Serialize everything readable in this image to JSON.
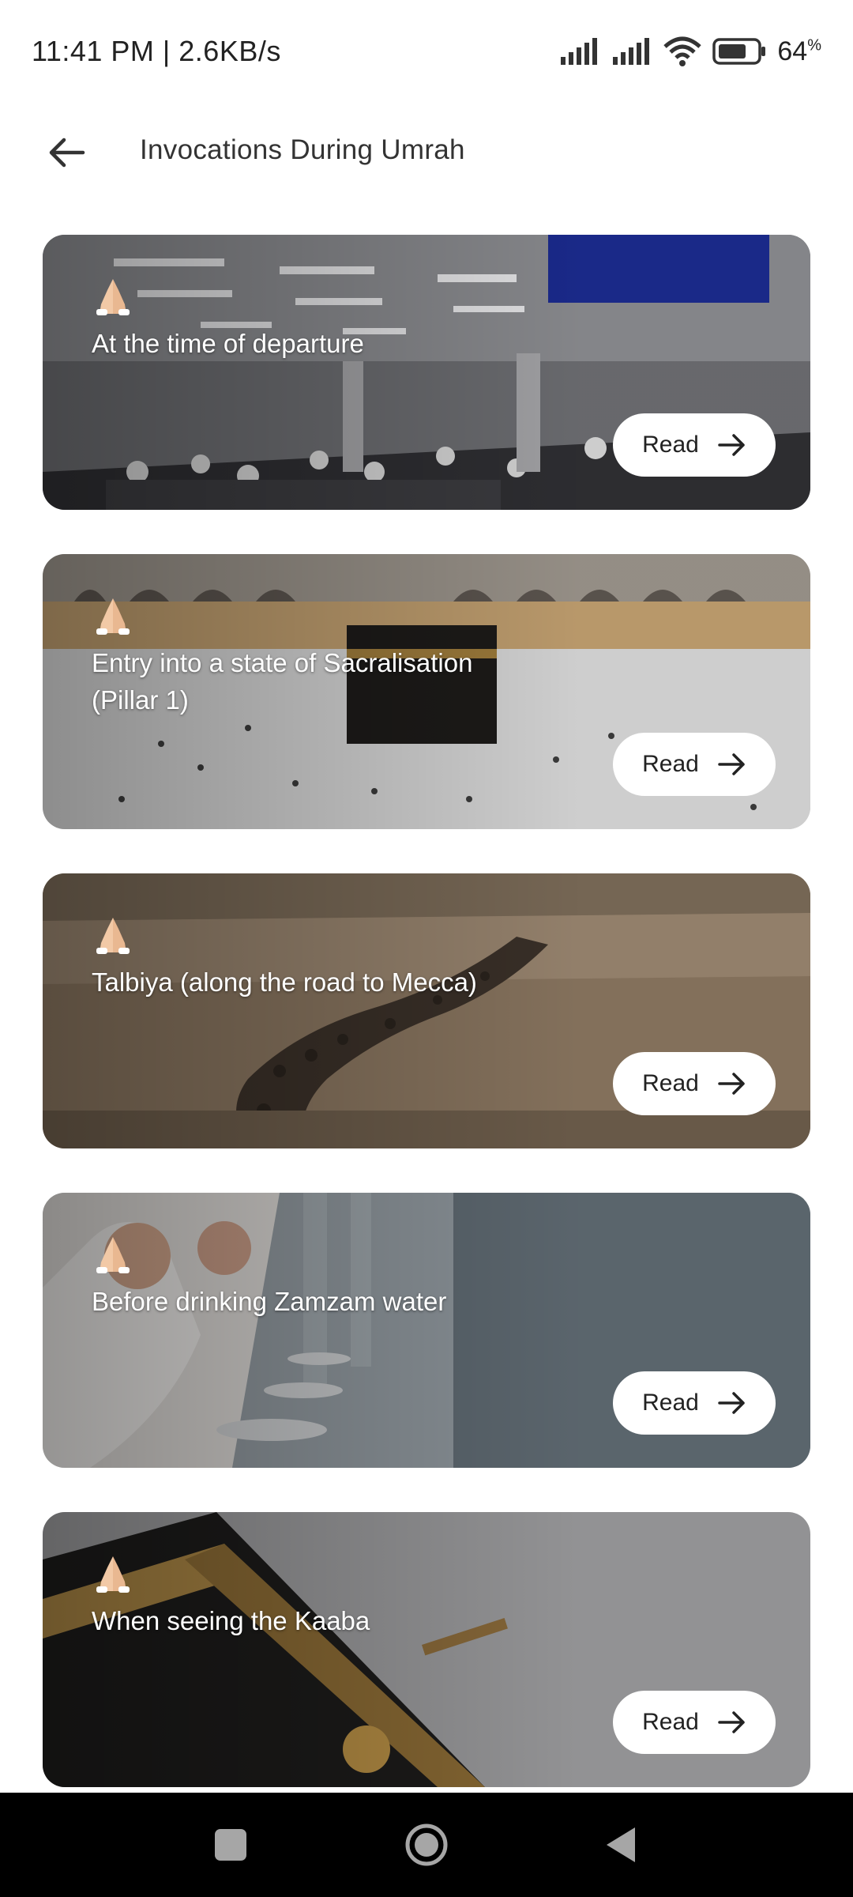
{
  "status": {
    "time_speed": "11:41 PM | 2.6KB/s",
    "battery": "64",
    "battery_unit": "%",
    "icons": [
      "signal-icon",
      "signal-icon",
      "wifi-icon",
      "battery-icon"
    ]
  },
  "header": {
    "title": "Invocations During Umrah",
    "back_icon": "arrow-left-icon"
  },
  "cards": [
    {
      "title": "At the time of departure",
      "button": "Read",
      "icon": "praying-hands-icon",
      "scene": "airport-terminal"
    },
    {
      "title": "Entry into a state of Sacralisation (Pillar 1)",
      "button": "Read",
      "icon": "praying-hands-icon",
      "scene": "kaaba-courtyard"
    },
    {
      "title": "Talbiya (along the road to Mecca)",
      "button": "Read",
      "icon": "praying-hands-icon",
      "scene": "desert-caravan"
    },
    {
      "title": "Before drinking Zamzam water",
      "button": "Read",
      "icon": "praying-hands-icon",
      "scene": "zamzam-taps"
    },
    {
      "title": "When seeing the Kaaba",
      "button": "Read",
      "icon": "praying-hands-icon",
      "scene": "kaaba-closeup"
    }
  ],
  "colors": {
    "card_text": "#ffffff",
    "button_bg": "#ffffff",
    "nav_bg": "#000000"
  },
  "navbar": [
    "recents-square-icon",
    "home-circle-icon",
    "back-triangle-icon"
  ]
}
